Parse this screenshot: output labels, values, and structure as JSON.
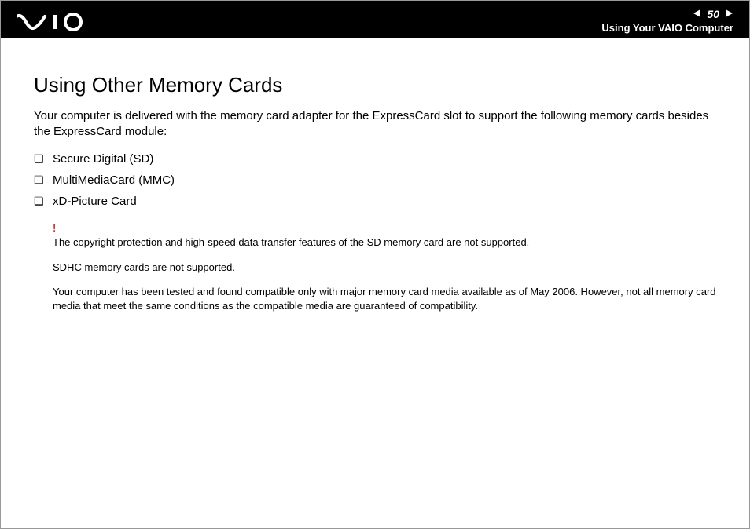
{
  "header": {
    "page_number": "50",
    "section": "Using Your VAIO Computer"
  },
  "content": {
    "title": "Using Other Memory Cards",
    "intro": "Your computer is delivered with the memory card adapter for the ExpressCard slot to support the following memory cards besides the ExpressCard module:",
    "list": [
      "Secure Digital (SD)",
      "MultiMediaCard (MMC)",
      "xD-Picture Card"
    ],
    "warn_symbol": "!",
    "notes": [
      "The copyright protection and high-speed data transfer features of the SD memory card are not supported.",
      "SDHC memory cards are not supported.",
      "Your computer has been tested and found compatible only with major memory card media available as of May 2006. However, not all memory card media that meet the same conditions as the compatible media are guaranteed of compatibility."
    ]
  }
}
